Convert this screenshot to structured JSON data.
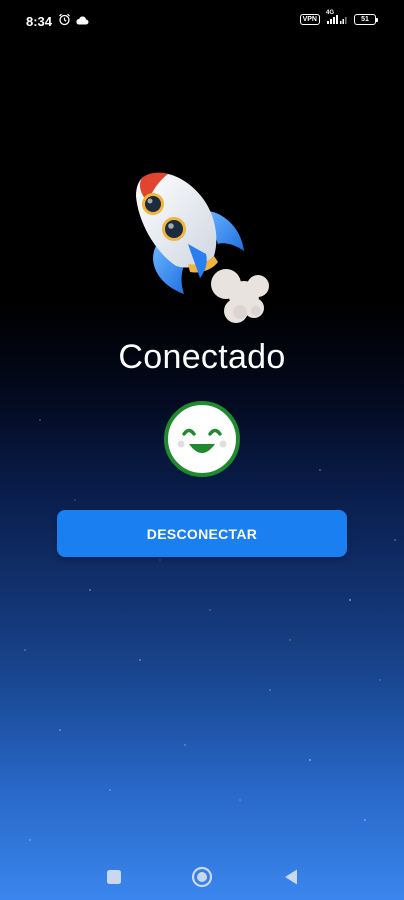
{
  "status_bar": {
    "time": "8:34",
    "vpn_label": "VPN",
    "network_label": "4G",
    "battery_level": "51",
    "icons": [
      "alarm-icon",
      "cloud-icon",
      "vpn-icon",
      "signal-icon",
      "battery-icon"
    ]
  },
  "main": {
    "status_text": "Conectado",
    "status_icon": "happy-face-icon",
    "illustration": "rocket-icon",
    "disconnect_label": "DESCONECTAR"
  },
  "nav": {
    "recent_icon": "square-icon",
    "home_icon": "circle-icon",
    "back_icon": "triangle-back-icon"
  },
  "colors": {
    "button": "#1a7ff0",
    "smiley_border": "#1f8a2e",
    "smiley_fill": "#ffffff",
    "background_top": "#000000",
    "background_bottom": "#3a86ee"
  }
}
